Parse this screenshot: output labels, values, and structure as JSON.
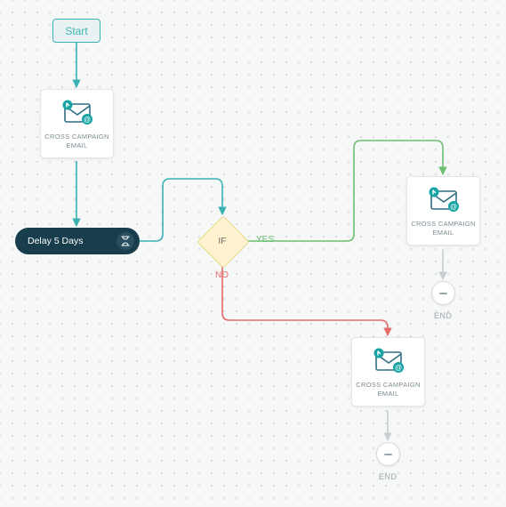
{
  "start": {
    "label": "Start"
  },
  "email1": {
    "title": "CROSS CAMPAIGN",
    "subtitle": "EMAIL"
  },
  "delay": {
    "label": "Delay 5 Days"
  },
  "decision": {
    "label": "IF",
    "yes": "YES",
    "no": "NO"
  },
  "emailYes": {
    "title": "CROSS CAMPAIGN",
    "subtitle": "EMAIL"
  },
  "emailNo": {
    "title": "CROSS CAMPAIGN",
    "subtitle": "EMAIL"
  },
  "endYes": {
    "label": "END"
  },
  "endNo": {
    "label": "END"
  },
  "colors": {
    "teal": "#3ab2b4",
    "green": "#6bbf6f",
    "red": "#e66a6a",
    "grey": "#c7cfd2"
  }
}
